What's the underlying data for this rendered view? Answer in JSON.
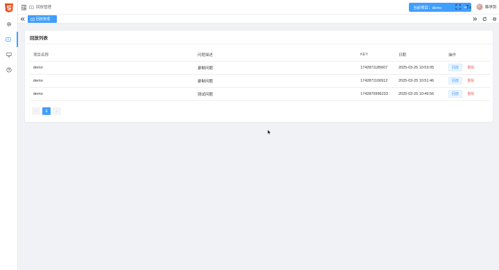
{
  "header": {
    "breadcrumb": "回放管理",
    "project_button": "当前项目：demo",
    "user_name": "韩学剑"
  },
  "tags": {
    "active_tag": "回放管理"
  },
  "card": {
    "title": "回放列表",
    "columns": [
      "项目名称",
      "问题描述",
      "KEY",
      "日期",
      "操作"
    ],
    "rows": [
      {
        "project": "demo",
        "desc": "录制问题",
        "key": "1742871185607",
        "date": "2025-03-25 10:53:05"
      },
      {
        "project": "demo",
        "desc": "录制问题",
        "key": "1742871106912",
        "date": "2025-03-25 10:51:46"
      },
      {
        "project": "demo",
        "desc": "测试问题",
        "key": "1742870996233",
        "date": "2025-03-25 10:49:56"
      }
    ],
    "action_replay": "回放",
    "action_delete": "删除"
  },
  "pagination": {
    "prev": "‹",
    "current": "1",
    "next": "›"
  },
  "colors": {
    "accent": "#409eff",
    "danger": "#f56c6c"
  },
  "icons": [
    "html5-logo-icon",
    "gear-icon",
    "replay-icon",
    "monitor-icon",
    "help-circle-icon",
    "menu-fold-icon",
    "fullscreen-icon",
    "font-size-icon",
    "double-left-icon",
    "double-right-icon",
    "refresh-icon",
    "settings-icon"
  ]
}
